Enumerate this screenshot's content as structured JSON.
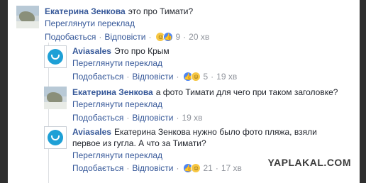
{
  "comments": [
    {
      "author": "Екатерина Зенкова",
      "text": "это про Тимати?",
      "translate": "Переглянути переклад",
      "like": "Подобається",
      "reply": "Відповісти",
      "reaction_count": "9",
      "time": "20 хв",
      "avatar_icon": "user-photo-icon"
    },
    {
      "author": "Aviasales",
      "text": "Это про Крым",
      "translate": "Переглянути переклад",
      "like": "Подобається",
      "reply": "Відповісти",
      "reaction_count": "5",
      "time": "19 хв",
      "avatar_icon": "aviasales-logo-icon"
    },
    {
      "author": "Екатерина Зенкова",
      "text": "а фото Тимати для чего при таком заголовке?",
      "translate": "Переглянути переклад",
      "like": "Подобається",
      "reply": "Відповісти",
      "time": "19 хв",
      "avatar_icon": "user-photo-icon"
    },
    {
      "author": "Aviasales",
      "text": "Екатерина Зенкова нужно было фото пляжа, взяли",
      "text2": "первое из гугла. А что за Тимати?",
      "translate": "Переглянути переклад",
      "like": "Подобається",
      "reply": "Відповісти",
      "reaction_count": "21",
      "time": "17 хв",
      "avatar_icon": "aviasales-logo-icon"
    }
  ],
  "separator": "·",
  "watermark": "YAPLAKAL.COM",
  "colors": {
    "link": "#365899",
    "meta": "#90949c",
    "frame": "#2f2f2f"
  }
}
